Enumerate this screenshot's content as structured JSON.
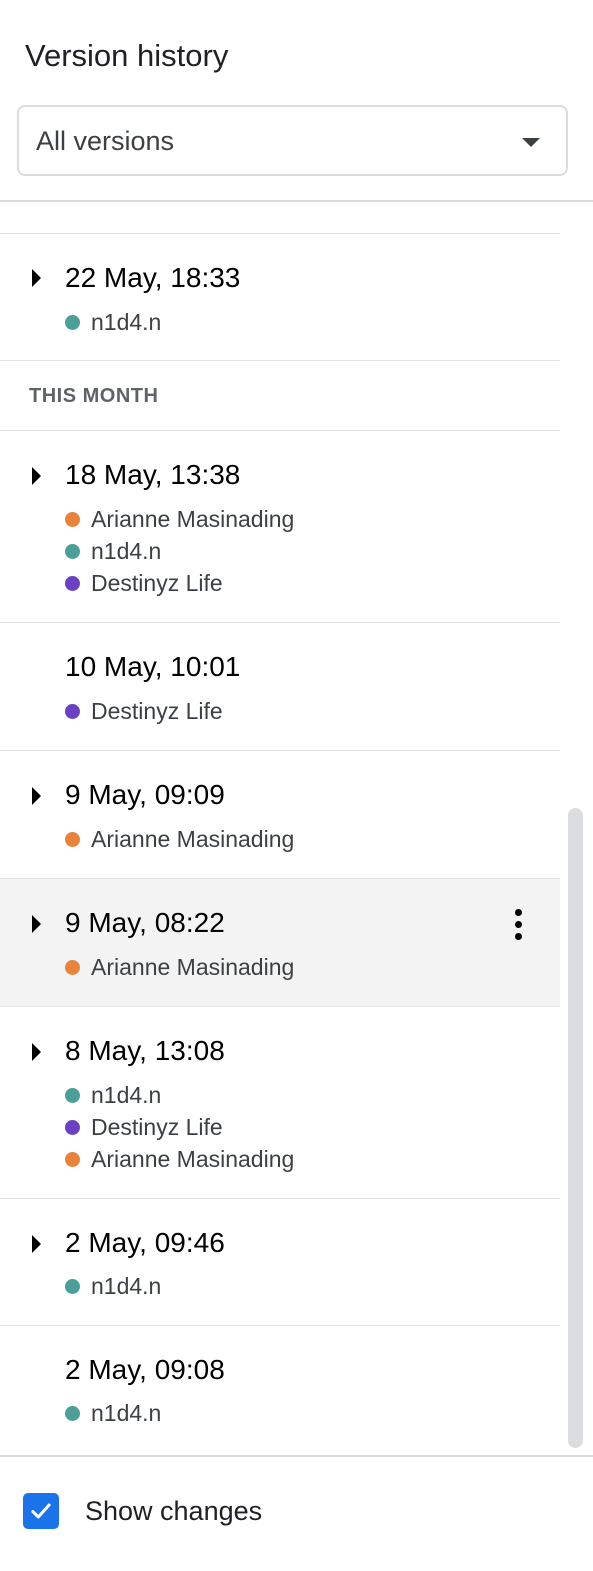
{
  "panel": {
    "title": "Version history",
    "filter": {
      "selected": "All versions",
      "icon": "caret-down-icon"
    }
  },
  "colors": {
    "accent": "#1a73e8",
    "author_orange": "#e8833a",
    "author_teal": "#4c9f97",
    "author_purple": "#6a41c2",
    "selected_row_bg": "#f3f3f3"
  },
  "sections": {
    "this_month": "THIS MONTH"
  },
  "versions": [
    {
      "date": "22 May, 18:33",
      "expandable": true,
      "authors": [
        {
          "name": "n1d4.n",
          "color": "#4c9f97"
        }
      ]
    },
    {
      "date": "18 May, 13:38",
      "expandable": true,
      "authors": [
        {
          "name": "Arianne Masinading",
          "color": "#e8833a"
        },
        {
          "name": "n1d4.n",
          "color": "#4c9f97"
        },
        {
          "name": "Destinyz Life",
          "color": "#6a41c2"
        }
      ]
    },
    {
      "date": "10 May, 10:01",
      "expandable": false,
      "authors": [
        {
          "name": "Destinyz Life",
          "color": "#6a41c2"
        }
      ]
    },
    {
      "date": "9 May, 09:09",
      "expandable": true,
      "authors": [
        {
          "name": "Arianne Masinading",
          "color": "#e8833a"
        }
      ]
    },
    {
      "date": "9 May, 08:22",
      "expandable": true,
      "selected": true,
      "authors": [
        {
          "name": "Arianne Masinading",
          "color": "#e8833a"
        }
      ]
    },
    {
      "date": "8 May, 13:08",
      "expandable": true,
      "authors": [
        {
          "name": "n1d4.n",
          "color": "#4c9f97"
        },
        {
          "name": "Destinyz Life",
          "color": "#6a41c2"
        },
        {
          "name": "Arianne Masinading",
          "color": "#e8833a"
        }
      ]
    },
    {
      "date": "2 May, 09:46",
      "expandable": true,
      "authors": [
        {
          "name": "n1d4.n",
          "color": "#4c9f97"
        }
      ]
    },
    {
      "date": "2 May, 09:08",
      "expandable": false,
      "authors": [
        {
          "name": "n1d4.n",
          "color": "#4c9f97"
        }
      ]
    }
  ],
  "footer": {
    "show_changes_label": "Show changes",
    "show_changes_checked": true
  }
}
